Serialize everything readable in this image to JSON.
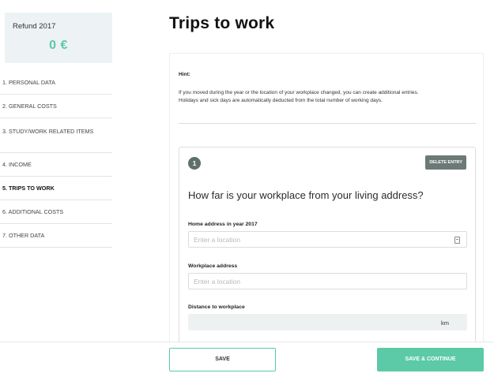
{
  "sidebar": {
    "refund_title": "Refund 2017",
    "refund_amount": "0 €",
    "items": [
      {
        "label": "1. PERSONAL DATA"
      },
      {
        "label": "2. GENERAL COSTS"
      },
      {
        "label": "3. STUDY/WORK RELATED ITEMS"
      },
      {
        "label": "4. INCOME"
      },
      {
        "label": "5. TRIPS TO WORK"
      },
      {
        "label": "6. ADDITIONAL COSTS"
      },
      {
        "label": "7. OTHER DATA"
      }
    ],
    "active_index": 4
  },
  "main": {
    "title": "Trips to work",
    "hint_label": "Hint:",
    "hint_line1": "If you moved during the year or the location of your workplace changed, you can create additional entries.",
    "hint_line2": "Holidays and sick days are automatically deducted from the total number of working days.",
    "entry": {
      "number": "1",
      "delete_label": "DELETE ENTRY",
      "question": "How far is your workplace from your living address?",
      "home_label": "Home address in year 2017",
      "home_placeholder": "Enter a location",
      "work_label": "Workplace address",
      "work_placeholder": "Enter a location",
      "distance_label": "Distance to workplace",
      "distance_unit": "km"
    }
  },
  "footer": {
    "save_label": "SAVE",
    "continue_label": "SAVE & CONTINUE"
  },
  "colors": {
    "accent": "#5cc9a7",
    "refund_bg": "#edf2f4",
    "badge": "#5f6f6c"
  },
  "icons": [
    "location-icon"
  ]
}
